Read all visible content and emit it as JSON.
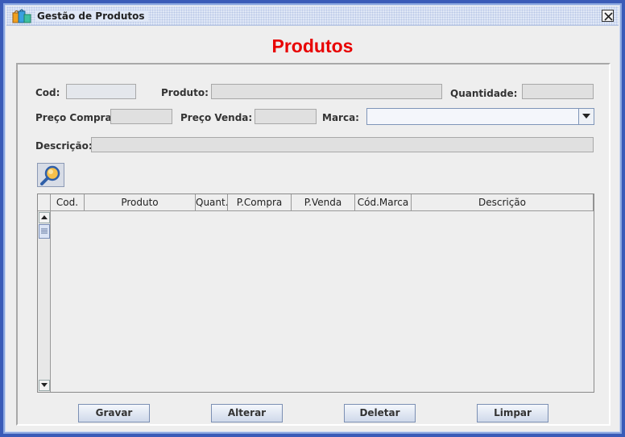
{
  "window": {
    "title": "Gestão de Produtos",
    "heading": "Produtos"
  },
  "form": {
    "cod_label": "Cod:",
    "produto_label": "Produto:",
    "quantidade_label": "Quantidade:",
    "preco_compra_label": "Preço Compra:",
    "preco_venda_label": "Preço Venda:",
    "marca_label": "Marca:",
    "descricao_label": "Descrição:",
    "cod_value": "",
    "produto_value": "",
    "quantidade_value": "",
    "preco_compra_value": "",
    "preco_venda_value": "",
    "marca_value": "",
    "descricao_value": ""
  },
  "table": {
    "columns": [
      "Cod.",
      "Produto",
      "Quant.",
      "P.Compra",
      "P.Venda",
      "Cód.Marca",
      "Descrição"
    ],
    "rows": []
  },
  "buttons": {
    "gravar": "Gravar",
    "alterar": "Alterar",
    "deletar": "Deletar",
    "limpar": "Limpar"
  },
  "icons": {
    "app": "shopping-bags-icon",
    "close": "close-icon",
    "search": "magnifier-icon"
  },
  "colors": {
    "heading": "#e80000",
    "desktop": "#3a5bb8",
    "window_bg": "#eeeeee"
  }
}
